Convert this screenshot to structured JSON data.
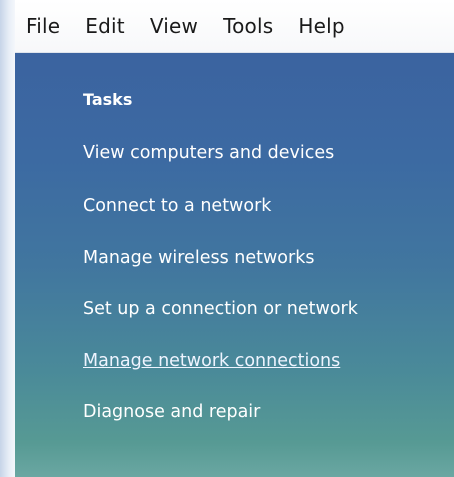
{
  "menubar": {
    "items": [
      {
        "label": "File"
      },
      {
        "label": "Edit"
      },
      {
        "label": "View"
      },
      {
        "label": "Tools"
      },
      {
        "label": "Help"
      }
    ]
  },
  "tasks": {
    "heading": "Tasks",
    "items": [
      {
        "label": "View computers and devices"
      },
      {
        "label": "Connect to a network"
      },
      {
        "label": "Manage wireless networks"
      },
      {
        "label": "Set up a connection or network"
      },
      {
        "label": "Manage network connections",
        "hovered": true
      },
      {
        "label": "Diagnose and repair"
      }
    ]
  },
  "colors": {
    "pane_top": "#3b63a0",
    "pane_bottom": "#6aa7a2",
    "text": "#ffffff"
  }
}
